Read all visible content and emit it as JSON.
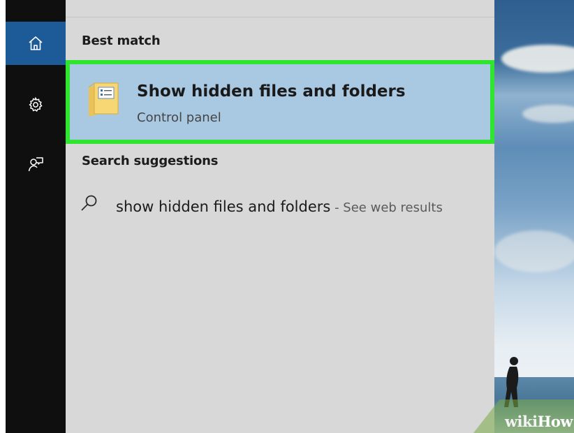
{
  "rail": {
    "items": [
      {
        "name": "home",
        "icon": "home-icon",
        "active": true
      },
      {
        "name": "settings",
        "icon": "gear-icon",
        "active": false
      },
      {
        "name": "feedback",
        "icon": "feedback-icon",
        "active": false
      }
    ]
  },
  "search": {
    "best_match_heading": "Best match",
    "best_match": {
      "icon": "folder-options-icon",
      "title": "Show hidden files and folders",
      "subtitle": "Control panel"
    },
    "suggestions_heading": "Search suggestions",
    "suggestions": [
      {
        "icon": "search-icon",
        "query": "show hidden files and folders",
        "separator": " - ",
        "hint": "See web results"
      }
    ]
  },
  "watermark": {
    "wiki": "wiki",
    "how": "How"
  },
  "colors": {
    "rail_bg": "#0f0f0f",
    "rail_active": "#1d5a98",
    "panel_bg": "#d8d8d8",
    "result_bg": "#a9c8e2",
    "highlight_border": "#2fe52f"
  }
}
